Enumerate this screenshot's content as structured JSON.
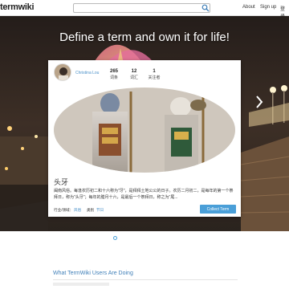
{
  "header": {
    "logo_text": "termwiki",
    "search_placeholder": "",
    "nav": [
      "About",
      "Sign up",
      "登录"
    ]
  },
  "hero": {
    "title": "Define a term and own it for life!"
  },
  "card": {
    "username": "Christina Lou",
    "stats": [
      {
        "value": "265",
        "label": "词条"
      },
      {
        "value": "12",
        "label": "词汇"
      },
      {
        "value": "1",
        "label": "关注者"
      }
    ],
    "term": "头牙",
    "description": "闽南风俗。每逢农历初二和十六称为\"牙\"，是拜拜土地公公的日子。农历二月初二，是每年的第一个祭拜日，称为\"头牙\"；每年的腊月十六，是最后一个祭拜日，称之为\"尾...",
    "industry_label": "行业/领域：",
    "industry_value": "风俗",
    "category_label": "类别",
    "category_value": "节日",
    "collect_button": "Collect Term"
  },
  "activity": {
    "title": "What TermWiki Users Are Doing"
  },
  "colors": {
    "accent": "#4a9fd8",
    "link": "#4a90c8"
  }
}
